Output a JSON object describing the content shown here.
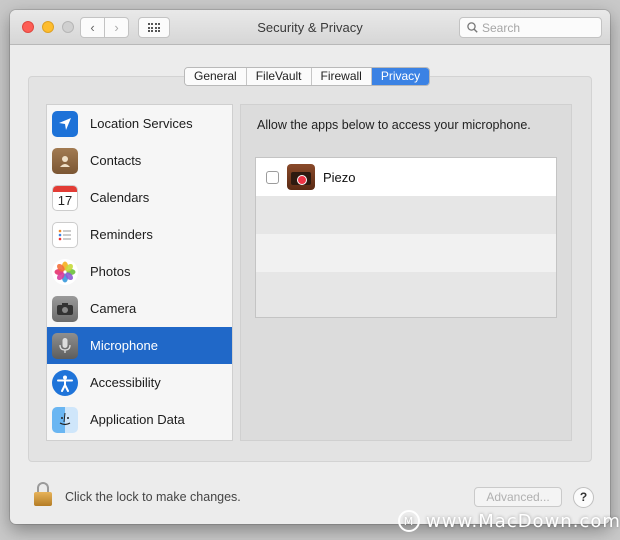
{
  "window": {
    "title": "Security & Privacy"
  },
  "toolbar": {
    "back_icon": "chevron-left-icon",
    "forward_icon": "chevron-right-icon",
    "grid_icon": "grid-icon"
  },
  "search": {
    "placeholder": "Search",
    "value": ""
  },
  "tabs": [
    {
      "label": "General",
      "active": false
    },
    {
      "label": "FileVault",
      "active": false
    },
    {
      "label": "Firewall",
      "active": false
    },
    {
      "label": "Privacy",
      "active": true
    }
  ],
  "sidebar": {
    "items": [
      {
        "label": "Location Services",
        "icon": "location-arrow-icon",
        "selected": false
      },
      {
        "label": "Contacts",
        "icon": "contacts-book-icon",
        "selected": false
      },
      {
        "label": "Calendars",
        "icon": "calendar-icon",
        "selected": false,
        "icon_text": "17"
      },
      {
        "label": "Reminders",
        "icon": "reminders-list-icon",
        "selected": false
      },
      {
        "label": "Photos",
        "icon": "photos-flower-icon",
        "selected": false
      },
      {
        "label": "Camera",
        "icon": "camera-icon",
        "selected": false
      },
      {
        "label": "Microphone",
        "icon": "microphone-icon",
        "selected": true
      },
      {
        "label": "Accessibility",
        "icon": "accessibility-icon",
        "selected": false
      },
      {
        "label": "Application Data",
        "icon": "finder-icon",
        "selected": false
      }
    ]
  },
  "content": {
    "description": "Allow the apps below to access your microphone.",
    "apps": [
      {
        "name": "Piezo",
        "checked": false,
        "icon": "piezo-app-icon"
      }
    ]
  },
  "footer": {
    "lock_text": "Click the lock to make changes.",
    "advanced_label": "Advanced...",
    "help_label": "?"
  },
  "watermark": {
    "text": "www.MacDown.com"
  },
  "colors": {
    "accent": "#2068c8",
    "tab_active": "#3b82e4"
  }
}
